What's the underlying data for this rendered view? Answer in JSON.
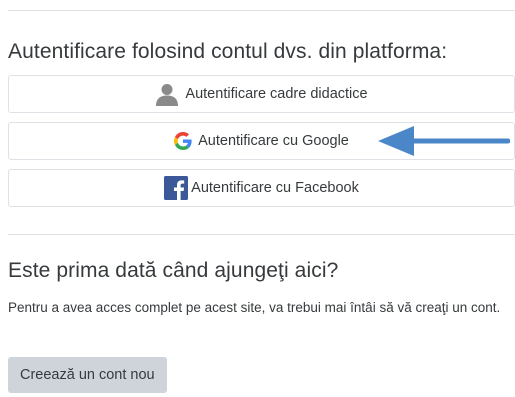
{
  "login_section": {
    "title": "Autentificare folosind contul dvs. din platforma:",
    "buttons": [
      {
        "label": "Autentificare cadre didactice",
        "icon": "user-silhouette-icon"
      },
      {
        "label": "Autentificare cu Google",
        "icon": "google-g-icon"
      },
      {
        "label": "Autentificare cu Facebook",
        "icon": "facebook-f-icon"
      }
    ]
  },
  "signup_section": {
    "title": "Este prima dată când ajungeţi aici?",
    "text": "Pentru a avea acces complet pe acest site, va trebui mai întâi să vă creaţi un cont.",
    "create_button_label": "Creează un cont nou"
  },
  "colors": {
    "arrow": "#4a86c8",
    "button_border": "#dee2e6",
    "create_button_bg": "#ced4da",
    "facebook_blue": "#3b5998",
    "user_icon_gray": "#8a8a8a"
  }
}
